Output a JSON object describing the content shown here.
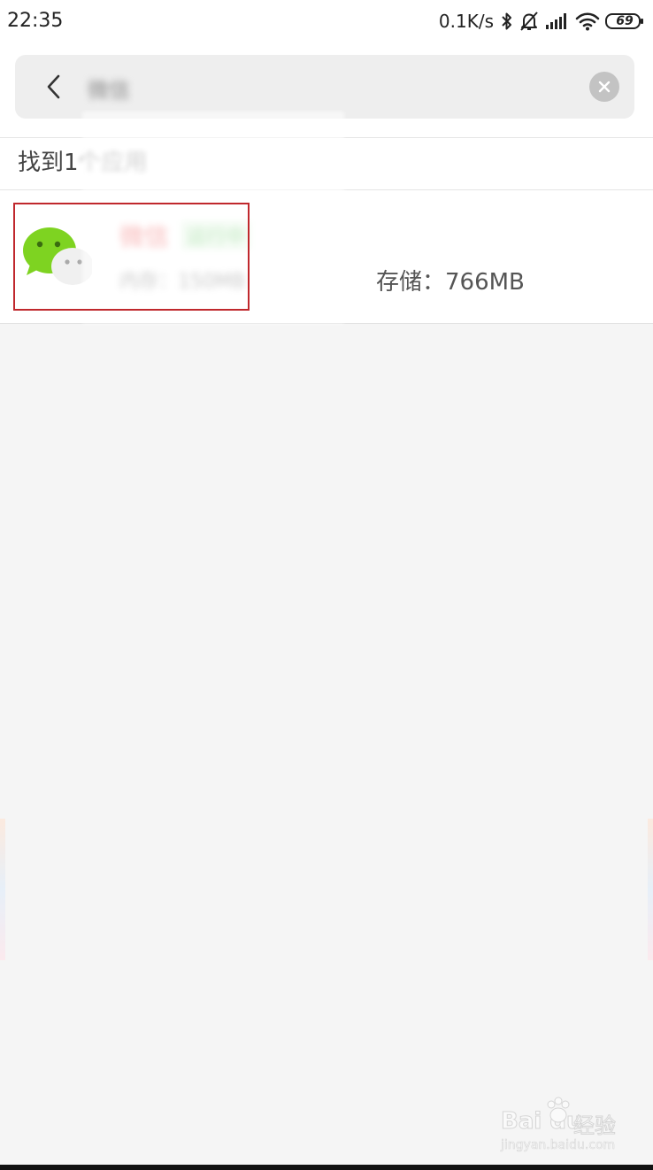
{
  "status_bar": {
    "time": "22:35",
    "net_speed": "0.1K/s",
    "battery_level": "69",
    "icons": [
      "bluetooth-icon",
      "mute-icon",
      "signal-icon",
      "wifi-icon",
      "battery-icon"
    ]
  },
  "search": {
    "query": "微信",
    "back_icon": "chevron-left-icon",
    "clear_icon": "close-icon"
  },
  "results": {
    "count_prefix": "找到1",
    "count_suffix": "个应用"
  },
  "app": {
    "name": "微信",
    "tag": "运行中",
    "memory": "内存：150MB",
    "storage": "存储：766MB",
    "icon": "wechat-icon"
  },
  "watermark": {
    "brand": "Bai du",
    "label": "经验",
    "url": "jingyan.baidu.com"
  },
  "colors": {
    "background": "#f5f5f5",
    "highlight": "#c0282d",
    "wechat_green": "#7ed321"
  }
}
